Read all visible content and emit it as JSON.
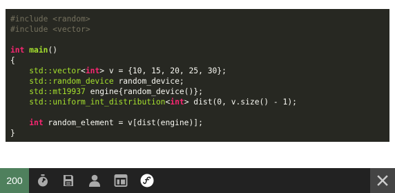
{
  "code": {
    "lines": [
      [
        {
          "t": "#include <random>",
          "k": "comment"
        }
      ],
      [
        {
          "t": "#include <vector>",
          "k": "comment"
        }
      ],
      [],
      [
        {
          "t": "int",
          "k": "type"
        },
        {
          "t": " ",
          "k": "plain"
        },
        {
          "t": "main",
          "k": "func"
        },
        {
          "t": "()",
          "k": "plain"
        }
      ],
      [
        {
          "t": "{",
          "k": "plain"
        }
      ],
      [
        {
          "t": "    ",
          "k": "plain"
        },
        {
          "t": "std::vector",
          "k": "ns"
        },
        {
          "t": "<",
          "k": "plain"
        },
        {
          "t": "int",
          "k": "type"
        },
        {
          "t": "> v = {10, 15, 20, 25, 30};",
          "k": "plain"
        }
      ],
      [
        {
          "t": "    ",
          "k": "plain"
        },
        {
          "t": "std::random_device",
          "k": "ns"
        },
        {
          "t": " random_device;",
          "k": "plain"
        }
      ],
      [
        {
          "t": "    ",
          "k": "plain"
        },
        {
          "t": "std::mt19937",
          "k": "ns"
        },
        {
          "t": " engine{random_device()};",
          "k": "plain"
        }
      ],
      [
        {
          "t": "    ",
          "k": "plain"
        },
        {
          "t": "std::uniform_int_distribution",
          "k": "ns"
        },
        {
          "t": "<",
          "k": "plain"
        },
        {
          "t": "int",
          "k": "type"
        },
        {
          "t": "> dist(0, v.size() - 1);",
          "k": "plain"
        }
      ],
      [],
      [
        {
          "t": "    ",
          "k": "plain"
        },
        {
          "t": "int",
          "k": "type"
        },
        {
          "t": " random_element = v[dist(engine)];",
          "k": "plain"
        }
      ],
      [
        {
          "t": "}",
          "k": "plain"
        }
      ]
    ]
  },
  "toolbar": {
    "status_code": "200",
    "status_color": "#4f805d",
    "icons": [
      "timer-icon",
      "memory-icon",
      "user-icon",
      "layout-icon",
      "symfony-icon"
    ],
    "close_icon": "close-icon"
  }
}
